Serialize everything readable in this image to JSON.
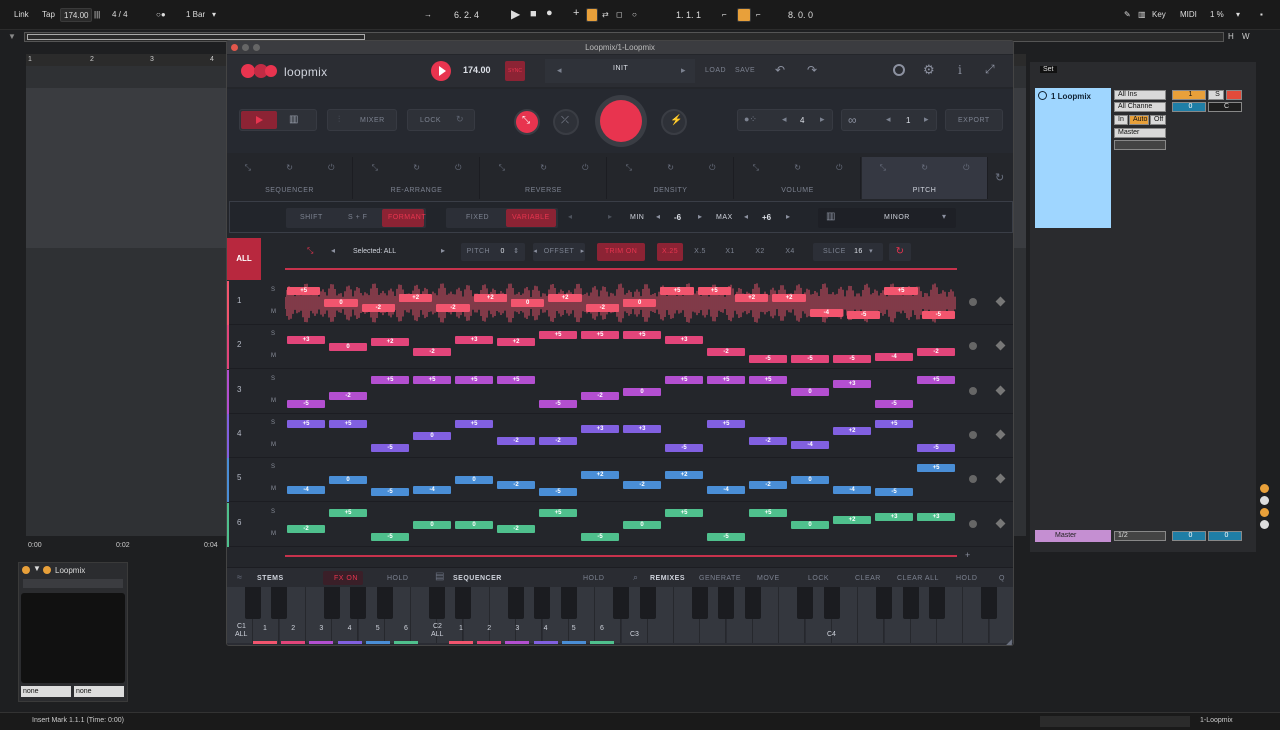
{
  "ableton": {
    "top": {
      "link": "Link",
      "tap": "Tap",
      "tempo": "174.00",
      "meter": "4 / 4",
      "quantize": "1 Bar",
      "position": "6. 2. 4",
      "loop_start": "1. 1. 1",
      "loop_length": "8. 0. 0",
      "key": "Key",
      "midi": "MIDI",
      "cpu": "1 %",
      "h": "H",
      "w": "W"
    },
    "ruler": [
      "1",
      "2",
      "3",
      "4"
    ],
    "timeline": [
      "0:00",
      "0:02",
      "0:04"
    ],
    "set_label": "Set",
    "track": {
      "name": "1 Loopmix",
      "input": "All Ins",
      "channel": "All Channe",
      "monitor": [
        "In",
        "Auto",
        "Off"
      ],
      "output": "Master",
      "number": "1",
      "solo": "S",
      "vol": "0",
      "pan": "C"
    },
    "master": {
      "name": "Master",
      "routing": "1/2",
      "vol": "0",
      "pan": "0"
    },
    "device": {
      "name": "Loopmix",
      "sel1": "none",
      "sel2": "none"
    },
    "status": {
      "text": "Insert Mark 1.1.1 (Time: 0:00)",
      "track": "1-Loopmix"
    }
  },
  "plugin": {
    "window_title": "Loopmix/1-Loopmix",
    "brand": "loopmix",
    "tempo": "174.00",
    "sync": "SYNC",
    "preset": "INIT",
    "load": "Load",
    "save": "Save",
    "mixer": "MIXER",
    "lock": "LOCK",
    "bars": "4",
    "loops": "1",
    "export": "EXPORT",
    "fx_tabs": [
      "SEQUENCER",
      "RE-ARRANGE",
      "REVERSE",
      "DENSITY",
      "VOLUME",
      "PITCH"
    ],
    "pitch": {
      "shift": "SHIFT",
      "sf": "S + F",
      "formant": "FORMANT",
      "fixed": "FIXED",
      "variable": "VARIABLE",
      "min_label": "MIN",
      "min": "-6",
      "max_label": "MAX",
      "max": "+6",
      "scale": "MINOR"
    },
    "options": {
      "all": "ALL",
      "selected": "Selected: ALL",
      "pitch_label": "PITCH",
      "pitch_value": "0",
      "offset": "OFFSET",
      "trim": "TRIM ON",
      "speeds": [
        "X.25",
        "X.5",
        "X1",
        "X2",
        "X4"
      ],
      "slice_label": "SLICE",
      "slice_value": "16"
    },
    "rows": [
      {
        "num": "1",
        "color": "#f2556e",
        "notes": [
          "+5",
          "0",
          "-2",
          "+2",
          "-2",
          "+2",
          "0",
          "+2",
          "-2",
          "0",
          "+5",
          "+5",
          "+2",
          "+2",
          "-4",
          "-5",
          "+5",
          "-5"
        ]
      },
      {
        "num": "2",
        "color": "#e2457a",
        "notes": [
          "+3",
          "0",
          "+2",
          "-2",
          "+3",
          "+2",
          "+5",
          "+5",
          "+5",
          "+3",
          "-2",
          "-5",
          "-5",
          "-5",
          "-4",
          "-2"
        ]
      },
      {
        "num": "3",
        "color": "#b34fd0",
        "notes": [
          "-5",
          "-2",
          "+5",
          "+5",
          "+5",
          "+5",
          "-5",
          "-2",
          "0",
          "+5",
          "+5",
          "+5",
          "0",
          "+3",
          "-5",
          "+5"
        ]
      },
      {
        "num": "4",
        "color": "#8160e0",
        "notes": [
          "+5",
          "+5",
          "-5",
          "0",
          "+5",
          "-2",
          "-2",
          "+3",
          "+3",
          "-5",
          "+5",
          "-2",
          "-4",
          "+2",
          "+5",
          "-5"
        ]
      },
      {
        "num": "5",
        "color": "#4a8ed6",
        "notes": [
          "-4",
          "0",
          "-5",
          "-4",
          "0",
          "-2",
          "-5",
          "+2",
          "-2",
          "+2",
          "-4",
          "-2",
          "0",
          "-4",
          "-5",
          "+5"
        ]
      },
      {
        "num": "6",
        "color": "#4fc08d",
        "notes": [
          "-2",
          "+5",
          "-5",
          "0",
          "0",
          "-2",
          "+5",
          "-5",
          "0",
          "+5",
          "-5",
          "+5",
          "0",
          "+2",
          "+3",
          "+3"
        ]
      }
    ],
    "footer": {
      "stems": "STEMS",
      "fx_on": "FX ON",
      "hold": "HOLD",
      "sequencer": "SEQUENCER",
      "hold2": "HOLD",
      "remixes": "REMIXES",
      "generate": "GENERATE",
      "move": "MOVE",
      "lock": "LOCK",
      "clear": "CLEAR",
      "clear_all": "CLEAR ALL",
      "hold3": "HOLD",
      "q": "Q"
    },
    "keys": {
      "c1": "C1",
      "c2": "C2",
      "c3": "C3",
      "c4": "C4",
      "all": "ALL",
      "nums": [
        "1",
        "2",
        "3",
        "4",
        "5",
        "6"
      ],
      "colors": [
        "#f2556e",
        "#e2457a",
        "#b34fd0",
        "#8160e0",
        "#4a8ed6",
        "#4fc08d"
      ]
    }
  }
}
